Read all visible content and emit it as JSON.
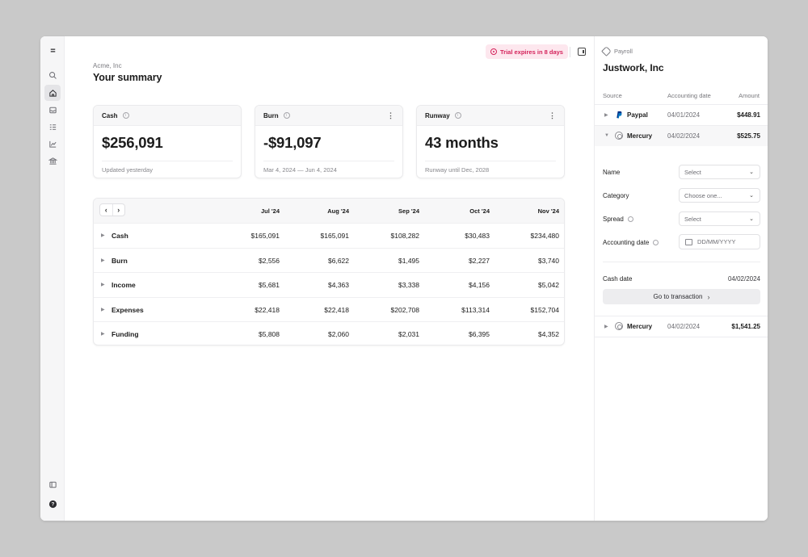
{
  "rail": {
    "icons": [
      "menu-icon",
      "search-icon",
      "home-icon",
      "inbox-icon",
      "list-icon",
      "chart-icon",
      "bank-icon",
      "panel-icon",
      "help-icon"
    ]
  },
  "header": {
    "company": "Acme, Inc",
    "title": "Your summary",
    "trial_label": "Trial expires in 8 days"
  },
  "cards": [
    {
      "title": "Cash",
      "value": "$256,091",
      "footer": "Updated yesterday"
    },
    {
      "title": "Burn",
      "value": "-$91,097",
      "footer": "Mar 4, 2024 — Jun 4, 2024"
    },
    {
      "title": "Runway",
      "value": "43 months",
      "footer": "Runway until Dec, 2028"
    }
  ],
  "table": {
    "columns": [
      "Jul '24",
      "Aug '24",
      "Sep '24",
      "Oct '24",
      "Nov '24"
    ],
    "rows": [
      {
        "label": "Cash",
        "values": [
          "$165,091",
          "$165,091",
          "$108,282",
          "$30,483",
          "$234,480"
        ]
      },
      {
        "label": "Burn",
        "values": [
          "$2,556",
          "$6,622",
          "$1,495",
          "$2,227",
          "$3,740"
        ]
      },
      {
        "label": "Income",
        "values": [
          "$5,681",
          "$4,363",
          "$3,338",
          "$4,156",
          "$5,042"
        ]
      },
      {
        "label": "Expenses",
        "values": [
          "$22,418",
          "$22,418",
          "$202,708",
          "$113,314",
          "$152,704"
        ]
      },
      {
        "label": "Funding",
        "values": [
          "$5,808",
          "$2,060",
          "$2,031",
          "$6,395",
          "$4,352"
        ]
      }
    ]
  },
  "side": {
    "tag": "Payroll",
    "title": "Justwork, Inc",
    "headers": {
      "source": "Source",
      "date": "Accounting date",
      "amount": "Amount"
    },
    "transactions": [
      {
        "source": "Paypal",
        "date": "04/01/2024",
        "amount": "$448.91"
      },
      {
        "source": "Mercury",
        "date": "04/02/2024",
        "amount": "$525.75"
      },
      {
        "source": "Mercury",
        "date": "04/02/2024",
        "amount": "$1,541.25"
      }
    ],
    "form": {
      "name_label": "Name",
      "name_value": "Select",
      "category_label": "Category",
      "category_value": "Choose one...",
      "spread_label": "Spread",
      "spread_value": "Select",
      "acct_date_label": "Accounting date",
      "acct_date_placeholder": "DD/MM/YYYY",
      "cash_date_label": "Cash date",
      "cash_date_value": "04/02/2024",
      "goto_label": "Go to transaction"
    }
  }
}
